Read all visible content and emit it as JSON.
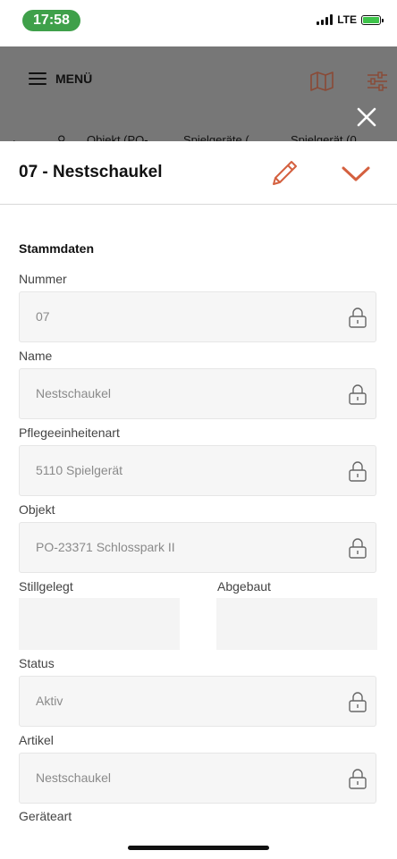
{
  "status": {
    "time": "17:58",
    "network": "LTE"
  },
  "header": {
    "menu_label": "MENÜ",
    "icons": [
      "menu-icon",
      "map-icon",
      "filter-icon"
    ]
  },
  "breadcrumbs": [
    "Objekt (PO-",
    "Spielgeräte (",
    "Spielgerät (0"
  ],
  "overlay": {
    "close_icon": "close-icon"
  },
  "sheet": {
    "title": "07 - Nestschaukel",
    "section_title": "Stammdaten",
    "fields": {
      "nummer": {
        "label": "Nummer",
        "value": "07"
      },
      "name": {
        "label": "Name",
        "value": "Nestschaukel"
      },
      "pflegeeinheitenart": {
        "label": "Pflegeeinheitenart",
        "value": "5110 Spielgerät"
      },
      "objekt": {
        "label": "Objekt",
        "value": "PO-23371 Schlosspark II"
      },
      "stillgelegt": {
        "label": "Stillgelegt",
        "value": ""
      },
      "abgebaut": {
        "label": "Abgebaut",
        "value": ""
      },
      "status": {
        "label": "Status",
        "value": "Aktiv"
      },
      "artikel": {
        "label": "Artikel",
        "value": "Nestschaukel"
      },
      "geraeteart": {
        "label": "Geräteart"
      }
    }
  },
  "colors": {
    "accent": "#d4603f",
    "status_pill": "#3fa04a",
    "overlay": "#777777"
  }
}
